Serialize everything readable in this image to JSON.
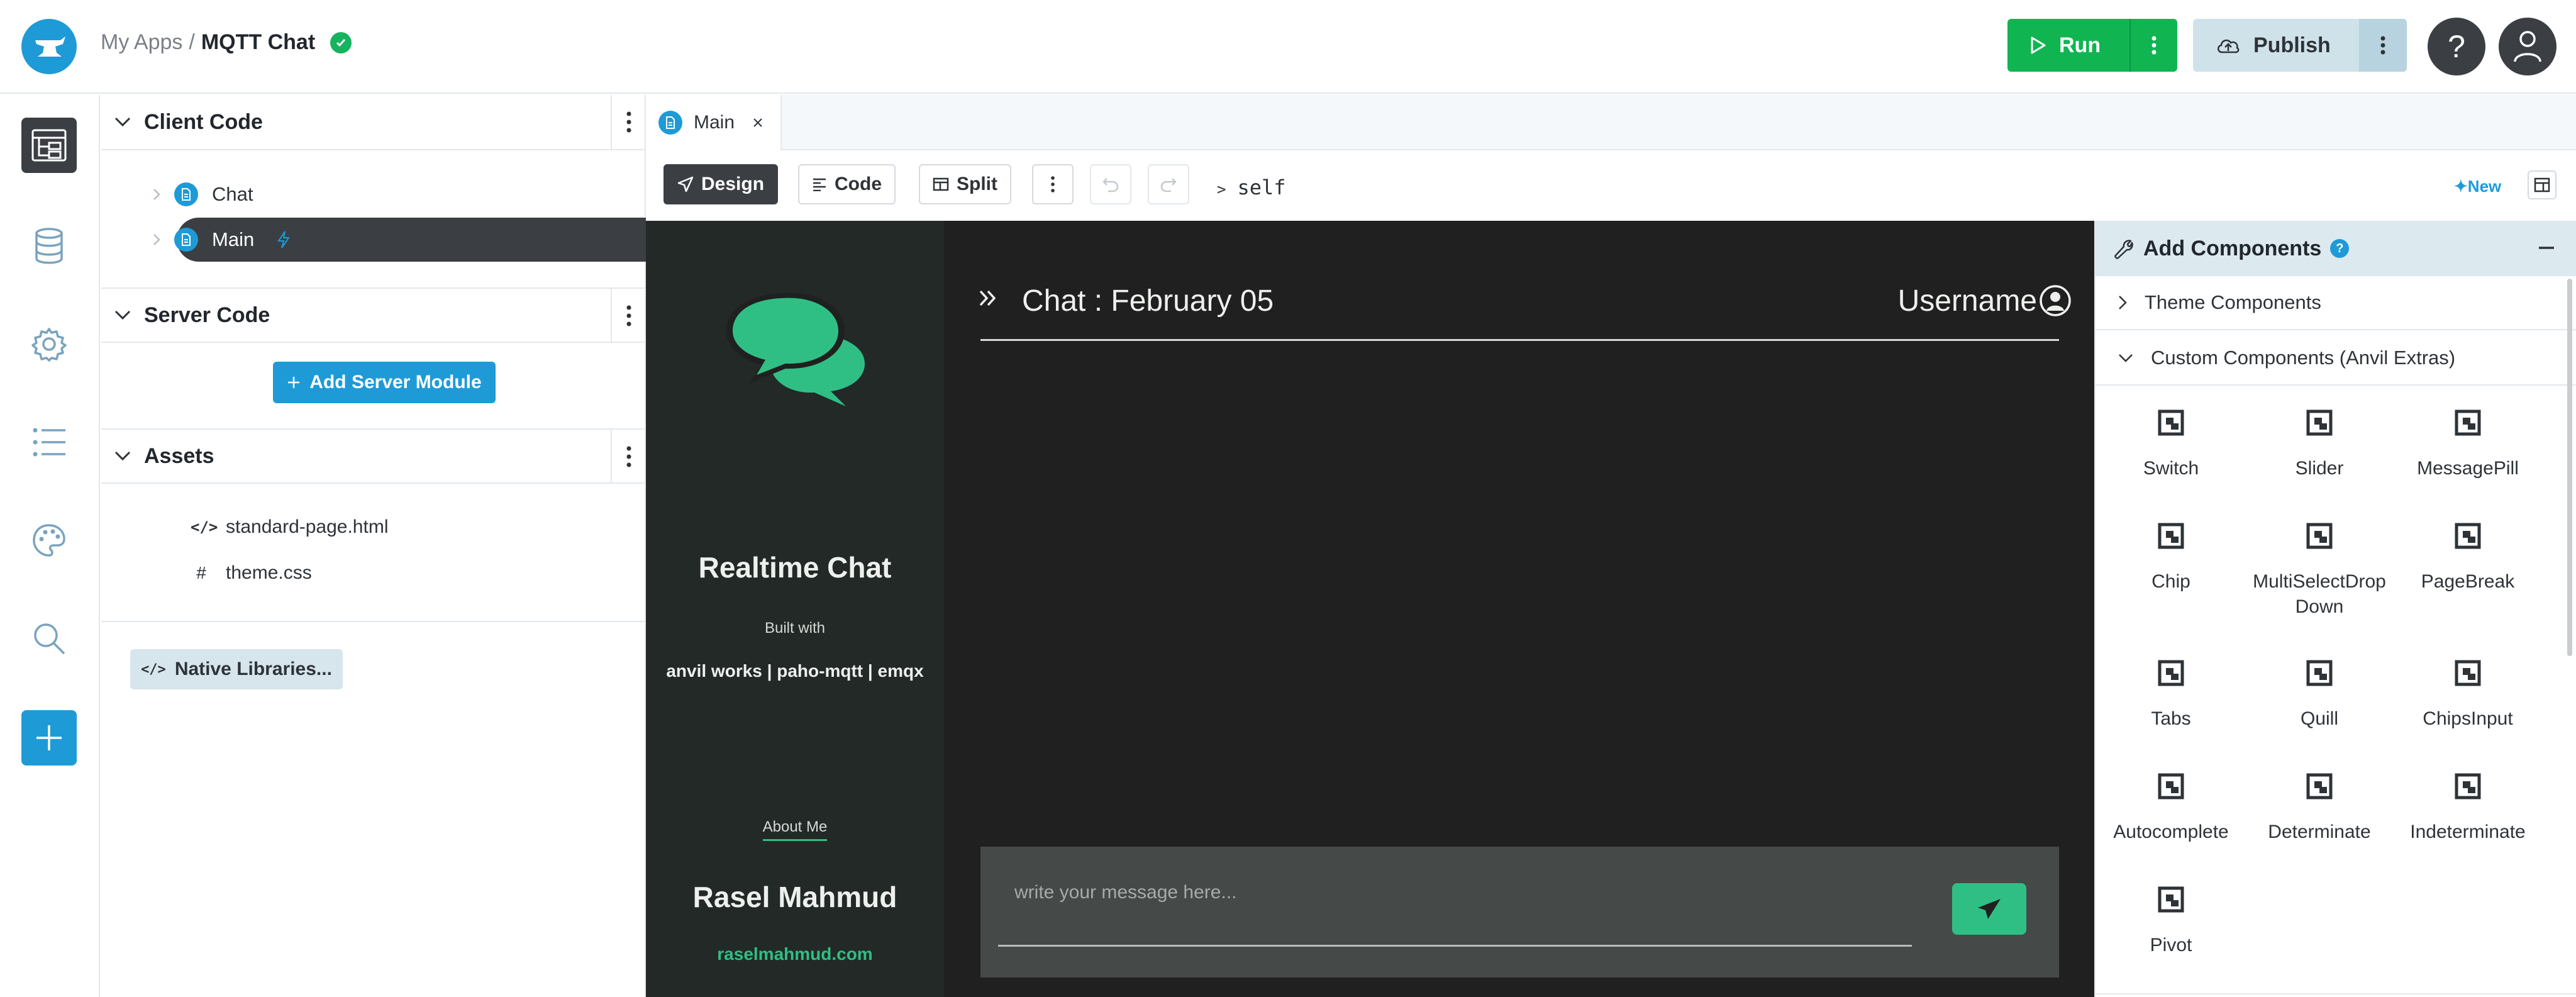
{
  "breadcrumb": {
    "root": "My Apps",
    "separator": "/",
    "app": "MQTT Chat"
  },
  "header": {
    "run_label": "Run",
    "publish_label": "Publish",
    "help_label": "?"
  },
  "sidebar": {
    "client_code": {
      "title": "Client Code",
      "items": [
        {
          "label": "Chat"
        },
        {
          "label": "Main"
        }
      ]
    },
    "server_code": {
      "title": "Server Code",
      "add_button": "Add Server Module"
    },
    "assets": {
      "title": "Assets",
      "items": [
        {
          "icon": "</>",
          "label": "standard-page.html"
        },
        {
          "icon": "#",
          "label": "theme.css"
        }
      ]
    },
    "native_libraries": "Native Libraries..."
  },
  "editor": {
    "tab_label": "Main",
    "toolbar": {
      "design": "Design",
      "code": "Code",
      "split": "Split",
      "path": "self",
      "new_label": "New"
    }
  },
  "app_preview": {
    "brand": "Realtime Chat",
    "built_with": "Built with",
    "stack": "anvil works | paho-mqtt | emqx",
    "about_link": "About Me",
    "author": "Rasel Mahmud",
    "website": "raselmahmud.com",
    "chat_title": "Chat : February 05",
    "username": "Username",
    "message_placeholder": "write your message here...",
    "accent_color": "#2fbf85"
  },
  "components_panel": {
    "title": "Add Components",
    "theme_category": "Theme Components",
    "custom_category": "Custom Components (Anvil Extras)",
    "items": [
      "Switch",
      "Slider",
      "MessagePill",
      "Chip",
      "MultiSelectDrop Down",
      "PageBreak",
      "Tabs",
      "Quill",
      "ChipsInput",
      "Autocomplete",
      "Determinate",
      "Indeterminate",
      "Pivot"
    ]
  }
}
